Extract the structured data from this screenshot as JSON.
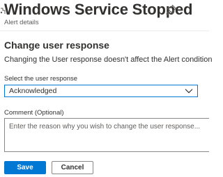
{
  "header": {
    "title": "Windows Service Stopped",
    "subtitle": "Alert details",
    "pin_icon": "pin-icon"
  },
  "section": {
    "title": "Change user response",
    "description": "Changing the User response doesn't affect the Alert condition"
  },
  "user_response": {
    "label": "Select the user response",
    "selected": "Acknowledged",
    "icon": "chevron-down-icon"
  },
  "comment": {
    "label": "Comment (Optional)",
    "value": "",
    "placeholder": "Enter the reason why you wish to change the user response..."
  },
  "buttons": {
    "save_label": "Save",
    "cancel_label": "Cancel"
  },
  "colors": {
    "accent": "#0078d4",
    "text": "#323130",
    "secondary_text": "#605e5c",
    "border": "#8a8886"
  }
}
